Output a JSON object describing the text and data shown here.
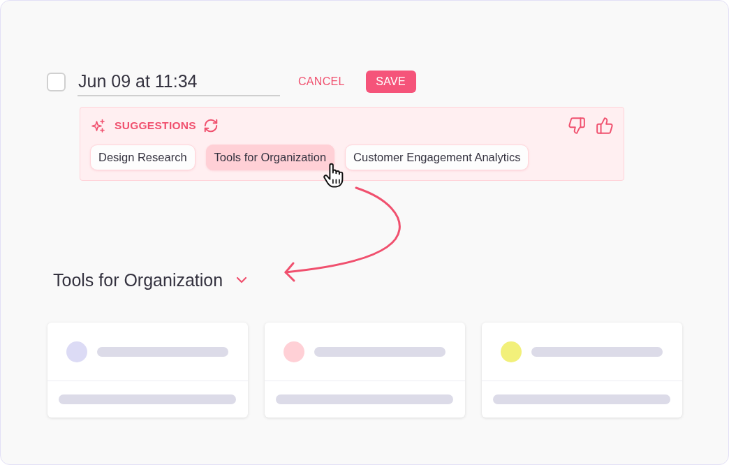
{
  "entry": {
    "checked": false,
    "value": "Jun 09 at 11:34"
  },
  "actions": {
    "cancel": "CANCEL",
    "save": "SAVE"
  },
  "suggestions": {
    "title": "SUGGESTIONS",
    "chips": [
      {
        "label": "Design Research",
        "selected": false
      },
      {
        "label": "Tools for Organization",
        "selected": true
      },
      {
        "label": "Customer Engagement Analytics",
        "selected": false
      }
    ]
  },
  "group": {
    "title": "Tools for Organization"
  },
  "cards": [
    {
      "color": "#dcdbf5"
    },
    {
      "color": "#ffd0d6"
    },
    {
      "color": "#f2f07a"
    }
  ]
}
